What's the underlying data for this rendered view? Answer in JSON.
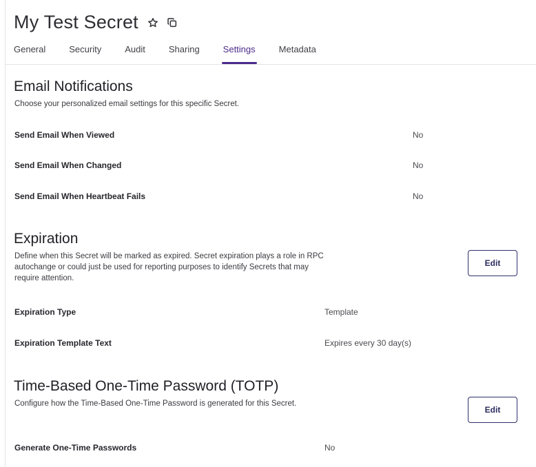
{
  "header": {
    "title": "My Test Secret",
    "favorite_icon": "star-outline-icon",
    "copy_icon": "copy-icon",
    "tabs": [
      {
        "label": "General"
      },
      {
        "label": "Security"
      },
      {
        "label": "Audit"
      },
      {
        "label": "Sharing"
      },
      {
        "label": "Settings",
        "active": true
      },
      {
        "label": "Metadata"
      }
    ]
  },
  "email": {
    "title": "Email Notifications",
    "description": "Choose your personalized email settings for this specific Secret.",
    "rows": [
      {
        "label": "Send Email When Viewed",
        "value": "No"
      },
      {
        "label": "Send Email When Changed",
        "value": "No"
      },
      {
        "label": "Send Email When Heartbeat Fails",
        "value": "No"
      }
    ]
  },
  "expiration": {
    "title": "Expiration",
    "description_lines": [
      "Define when this Secret will be marked as expired. Secret expiration plays a role in RPC",
      "autochange or could just be used for reporting purposes to identify Secrets that may",
      "require attention."
    ],
    "edit_label": "Edit",
    "rows": [
      {
        "label": "Expiration Type",
        "value": "Template"
      },
      {
        "label": "Expiration Template Text",
        "value": "Expires every 30 day(s)"
      }
    ]
  },
  "totp": {
    "title": "Time-Based One-Time Password (TOTP)",
    "description": "Configure how the Time-Based One-Time Password is generated for this Secret.",
    "edit_label": "Edit",
    "rows": [
      {
        "label": "Generate One-Time Passwords",
        "value": "No"
      }
    ]
  },
  "colors": {
    "accent": "#4b2b8a",
    "button_border": "#2e2e6e"
  }
}
